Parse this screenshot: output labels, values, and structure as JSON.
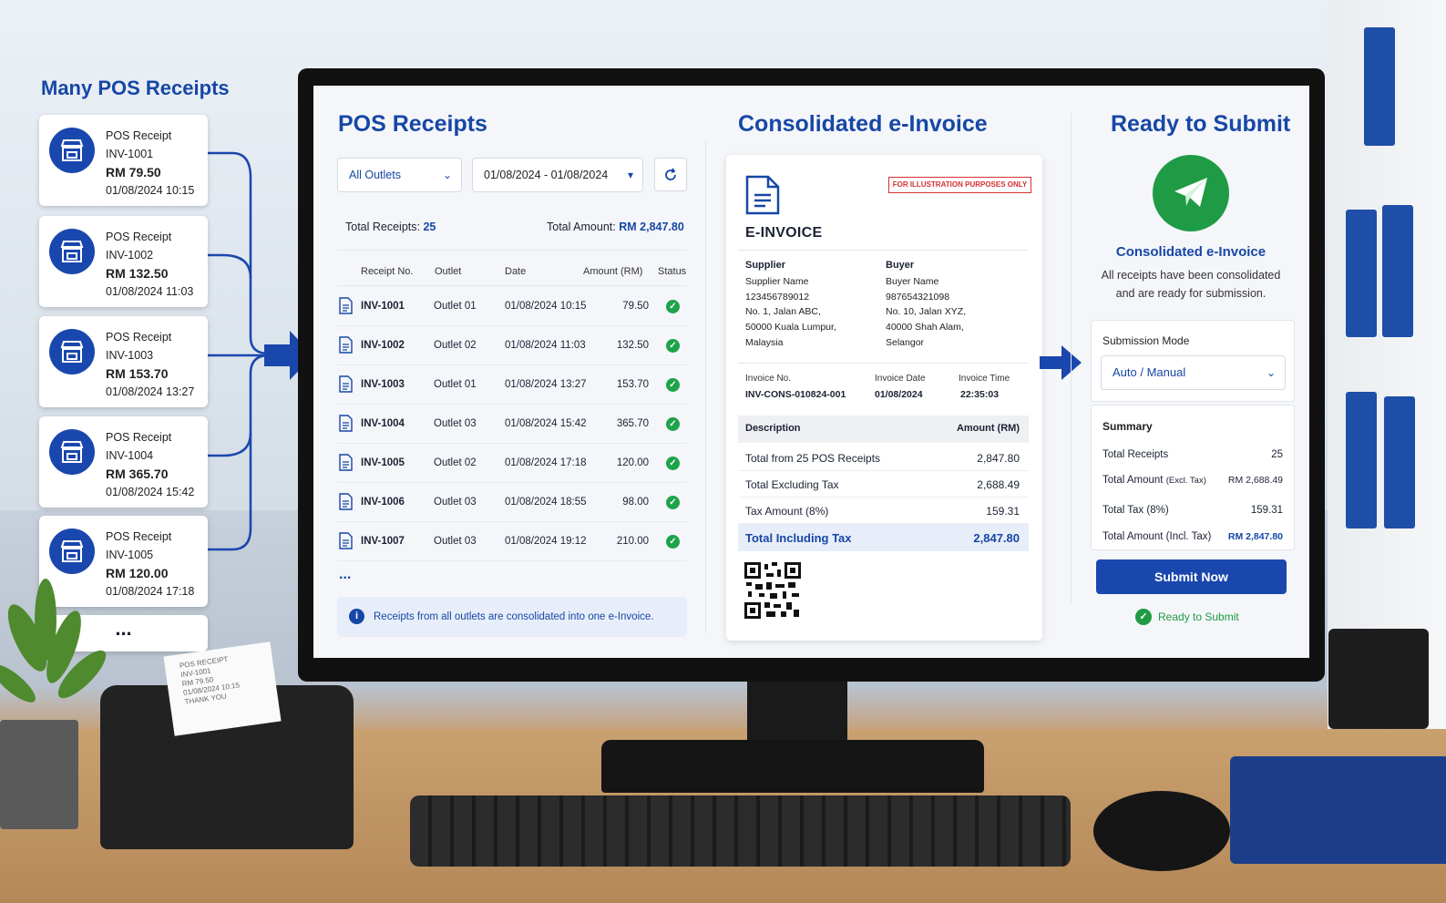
{
  "left_panel": {
    "title": "Many POS Receipts",
    "receipts": [
      {
        "type": "POS Receipt",
        "no": "INV-1001",
        "amount": "RM 79.50",
        "datetime": "01/08/2024 10:15"
      },
      {
        "type": "POS Receipt",
        "no": "INV-1002",
        "amount": "RM 132.50",
        "datetime": "01/08/2024 11:03"
      },
      {
        "type": "POS Receipt",
        "no": "INV-1003",
        "amount": "RM 153.70",
        "datetime": "01/08/2024 13:27"
      },
      {
        "type": "POS Receipt",
        "no": "INV-1004",
        "amount": "RM 365.70",
        "datetime": "01/08/2024 15:42"
      },
      {
        "type": "POS Receipt",
        "no": "INV-1005",
        "amount": "RM 120.00",
        "datetime": "01/08/2024 17:18"
      }
    ],
    "more": "..."
  },
  "printer_paper": {
    "lines": [
      "POS RECEIPT",
      "INV-1001",
      "RM 79.50",
      "01/08/2024 10:15",
      "THANK YOU"
    ]
  },
  "pos": {
    "title": "POS Receipts",
    "outlet_select": "All Outlets",
    "date_range": "01/08/2024 - 01/08/2024",
    "total_receipts_label": "Total Receipts:",
    "total_receipts_value": "25",
    "total_amount_label": "Total Amount:",
    "total_amount_value": "RM 2,847.80",
    "columns": [
      "Receipt No.",
      "Outlet",
      "Date",
      "Amount (RM)",
      "Status"
    ],
    "rows": [
      {
        "no": "INV-1001",
        "outlet": "Outlet 01",
        "date": "01/08/2024 10:15",
        "amount": "79.50"
      },
      {
        "no": "INV-1002",
        "outlet": "Outlet 02",
        "date": "01/08/2024 11:03",
        "amount": "132.50"
      },
      {
        "no": "INV-1003",
        "outlet": "Outlet 01",
        "date": "01/08/2024 13:27",
        "amount": "153.70"
      },
      {
        "no": "INV-1004",
        "outlet": "Outlet 03",
        "date": "01/08/2024 15:42",
        "amount": "365.70"
      },
      {
        "no": "INV-1005",
        "outlet": "Outlet 02",
        "date": "01/08/2024 17:18",
        "amount": "120.00"
      },
      {
        "no": "INV-1006",
        "outlet": "Outlet 03",
        "date": "01/08/2024 18:55",
        "amount": "98.00"
      },
      {
        "no": "INV-1007",
        "outlet": "Outlet 03",
        "date": "01/08/2024 19:12",
        "amount": "210.00"
      }
    ],
    "more": "...",
    "info_note": "Receipts from all outlets are consolidated into one e-Invoice."
  },
  "einvoice": {
    "title": "Consolidated e-Invoice",
    "stamp": "FOR ILLUSTRATION PURPOSES ONLY",
    "heading": "E-INVOICE",
    "supplier_title": "Supplier",
    "supplier_lines": "Supplier Name\n123456789012\nNo. 1, Jalan ABC,\n50000 Kuala Lumpur,\nMalaysia",
    "buyer_title": "Buyer",
    "buyer_lines": "Buyer Name\n987654321098\nNo. 10, Jalan XYZ,\n40000 Shah Alam,\nSelangor",
    "invoice_no_label": "Invoice No.",
    "invoice_no": "INV-CONS-010824-001",
    "invoice_date_label": "Invoice Date",
    "invoice_date": "01/08/2024",
    "invoice_time_label": "Invoice Time",
    "invoice_time": "22:35:03",
    "desc_header": "Description",
    "amount_header": "Amount (RM)",
    "lines": [
      {
        "desc": "Total from 25 POS Receipts",
        "amount": "2,847.80"
      },
      {
        "desc": "Total Excluding Tax",
        "amount": "2,688.49"
      },
      {
        "desc": "Tax Amount (8%)",
        "amount": "159.31"
      }
    ],
    "total_label": "Total Including Tax",
    "total_value": "2,847.80"
  },
  "submit_panel": {
    "title": "Ready to Submit",
    "subtitle": "Consolidated e-Invoice",
    "desc_line1": "All receipts have been consolidated",
    "desc_line2": "and are ready for submission.",
    "mode_label": "Submission Mode",
    "mode_value": "Auto / Manual",
    "summary_title": "Summary",
    "summary": {
      "receipts_label": "Total Receipts",
      "receipts_value": "25",
      "amount_label": "Total Amount",
      "amount_suffix": "(Excl. Tax)",
      "amount_value": "RM 2,688.49",
      "tax_label": "Total Tax (8%)",
      "tax_value": "159.31",
      "incl_label": "Total Amount (Incl. Tax)",
      "incl_value": "RM 2,847.80"
    },
    "submit_button": "Submit Now",
    "ready_text": "Ready to Submit"
  },
  "colors": {
    "accent": "#1747a6",
    "success": "#1f9b45",
    "stamp": "#d43131"
  }
}
